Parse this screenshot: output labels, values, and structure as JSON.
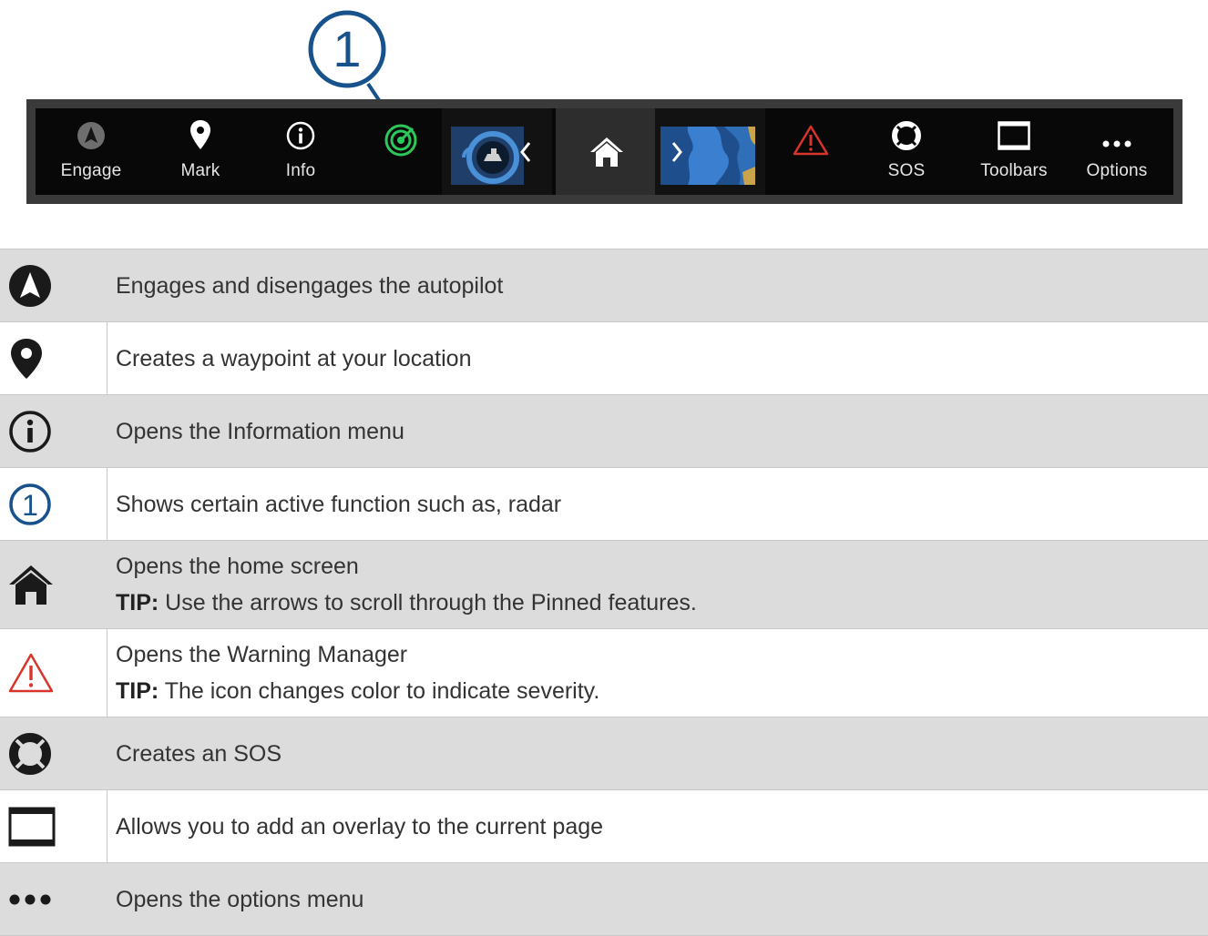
{
  "callout": {
    "number": "1",
    "color": "#17528c"
  },
  "toolbar": {
    "engage_label": "Engage",
    "mark_label": "Mark",
    "info_label": "Info",
    "home_icon": "home-icon",
    "warning_icon": "warning-icon",
    "sos_label": "SOS",
    "toolbars_label": "Toolbars",
    "options_label": "Options",
    "active_function_icon": "radar-icon",
    "accent_green": "#2cc95a",
    "warning_color": "#d9342b"
  },
  "legend": {
    "rows": [
      {
        "icon": "autopilot-icon",
        "text": "Engages and disengages the autopilot"
      },
      {
        "icon": "map-pin-icon",
        "text": "Creates a waypoint at your location"
      },
      {
        "icon": "info-icon",
        "text": "Opens the Information menu"
      },
      {
        "icon": "callout-1-icon",
        "text": "Shows certain active function such as, radar"
      },
      {
        "icon": "home-icon",
        "text": "Opens the home screen",
        "tip_label": "TIP:",
        "tip_text": " Use the arrows to scroll through the Pinned features."
      },
      {
        "icon": "warning-icon",
        "text": "Opens the Warning Manager",
        "tip_label": "TIP:",
        "tip_text": " The icon changes color to indicate severity."
      },
      {
        "icon": "lifebuoy-icon",
        "text": "Creates an SOS"
      },
      {
        "icon": "overlay-icon",
        "text": "Allows you to add an overlay to the current page"
      },
      {
        "icon": "more-icon",
        "text": "Opens the options menu"
      }
    ]
  }
}
